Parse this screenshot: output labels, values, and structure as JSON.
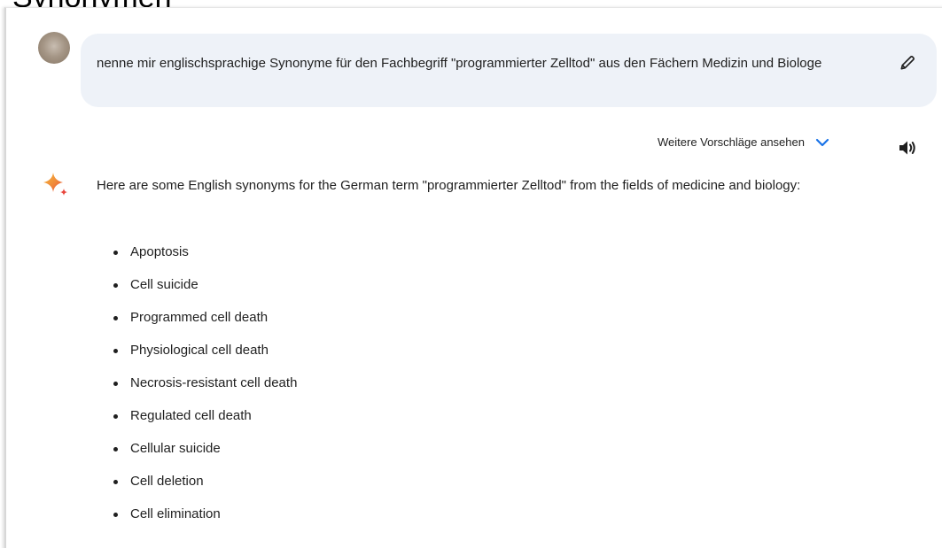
{
  "page": {
    "cut_heading": "Synonymen"
  },
  "user_prompt": {
    "text": "nenne mir englischsprachige Synonyme für den Fachbegriff \"programmierter Zelltod\" aus den Fächern Medizin und Biologe",
    "edit_icon": "pencil-icon"
  },
  "response": {
    "drafts_label": "Weitere Vorschläge ansehen",
    "drafts_icon": "chevron-down-icon",
    "speaker_icon": "speaker-icon",
    "model_icon": "sparkle-icon",
    "intro": "Here are some English synonyms for the German term \"programmierter Zelltod\" from the fields of medicine and biology:",
    "items": [
      "Apoptosis",
      "Cell suicide",
      "Programmed cell death",
      "Physiological cell death",
      "Necrosis-resistant cell death",
      "Regulated cell death",
      "Cellular suicide",
      "Cell deletion",
      "Cell elimination"
    ]
  },
  "colors": {
    "bubble_bg": "#eef2f8",
    "text": "#1f1f1f",
    "accent_blue": "#1a73e8",
    "sparkle_orange": "#f2a33a",
    "sparkle_red": "#e8453c"
  }
}
